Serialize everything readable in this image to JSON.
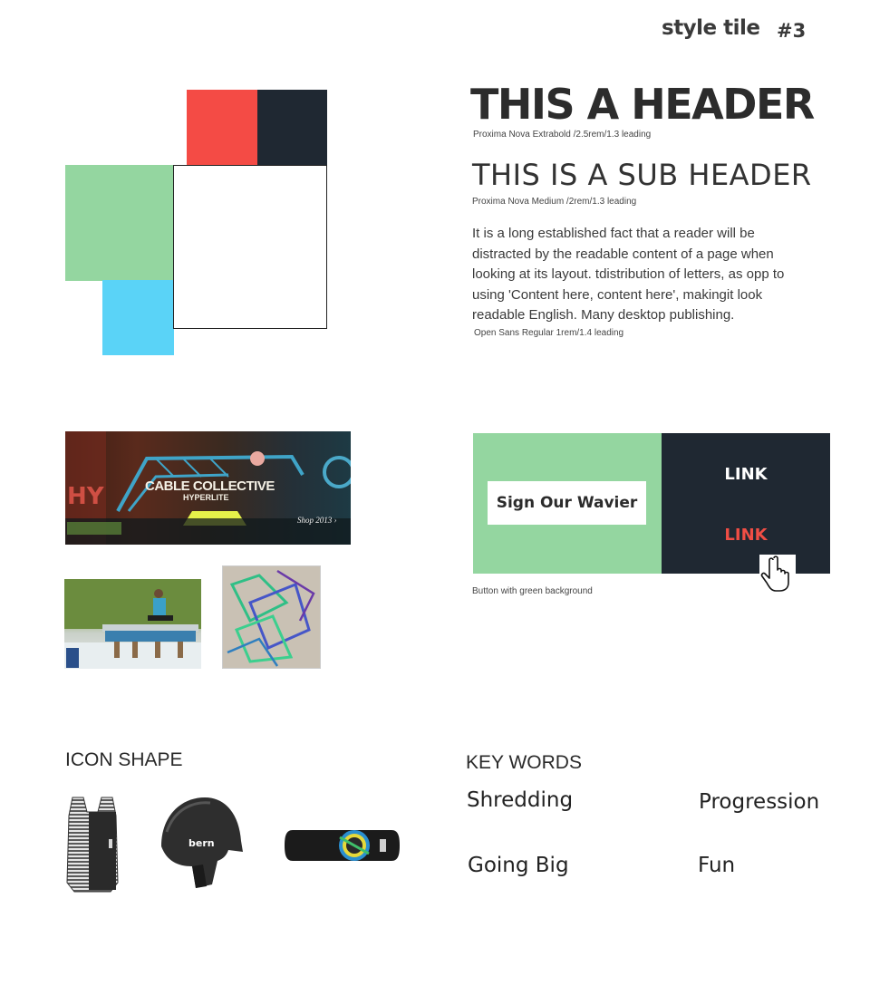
{
  "tile": {
    "title": "style tile",
    "number": "#3"
  },
  "palette": {
    "red": "#f44b45",
    "dark": "#1f2832",
    "green": "#94d6a0",
    "blue": "#5ad3f7",
    "white": "#ffffff"
  },
  "typography": {
    "header": "THIS A HEADER",
    "header_caption": "Proxima Nova Extrabold /2.5rem/1.3 leading",
    "subheader": "THIS IS A SUB HEADER",
    "subheader_caption": "Proxima Nova Medium /2rem/1.3 leading",
    "body": "It is a long established fact that a reader will be distracted by the readable content of a page when looking at its layout. tdistribution of letters, as opp to using 'Content here, content here', makingit look readable English. Many desktop publishing.",
    "body_caption": "Open Sans Regular 1rem/1.4 leading"
  },
  "images": {
    "banner_title": "CABLE COLLECTIVE",
    "banner_brand": "HYPERLITE",
    "banner_shop": "Shop 2013 ›"
  },
  "buttons": {
    "cta_label": "Sign Our Wavier",
    "link1": "LINK",
    "link2": "LINK",
    "caption": "Button with green background",
    "cursor_icon": "hand-pointer-icon"
  },
  "sections": {
    "icon_shape": "ICON SHAPE",
    "key_words": "KEY WORDS"
  },
  "icons": [
    "vest-icon",
    "helmet-icon",
    "wakeboard-icon"
  ],
  "helmet_brand": "bern",
  "keywords": [
    "Shredding",
    "Progression",
    "Going Big",
    "Fun"
  ]
}
